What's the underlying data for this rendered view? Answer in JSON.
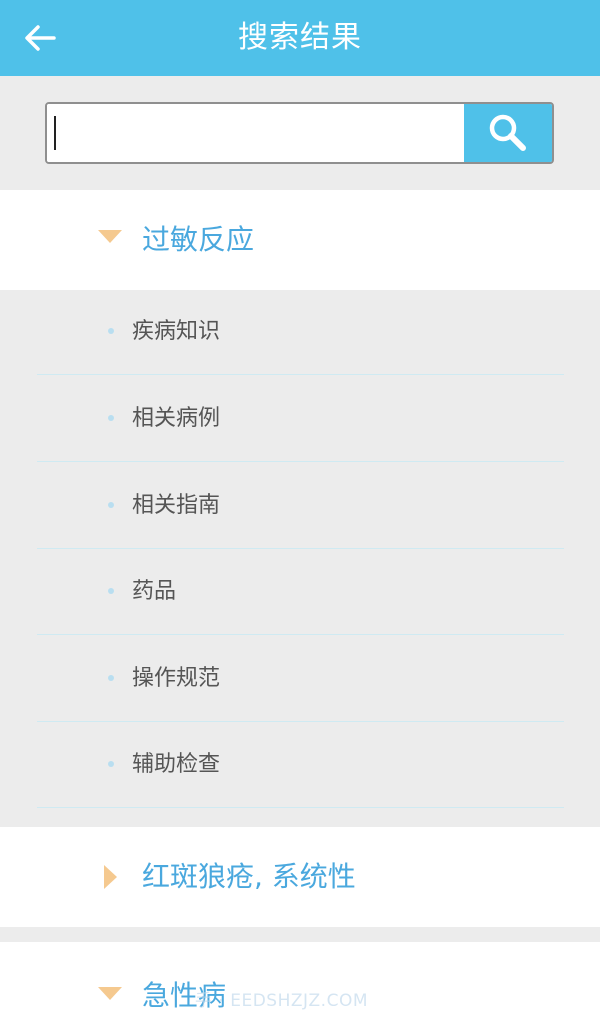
{
  "header": {
    "title": "搜索结果",
    "back_icon": "arrow-left-icon",
    "color": "#4fc1e9"
  },
  "search": {
    "value": "",
    "placeholder": "",
    "icon": "magnifier-icon"
  },
  "groups": [
    {
      "label": "过敏反应",
      "expanded": true
    },
    {
      "label": "红斑狼疮, 系统性",
      "expanded": false
    },
    {
      "label": "急性病",
      "expanded": true
    }
  ],
  "subitems": [
    {
      "label": "疾病知识"
    },
    {
      "label": "相关病例"
    },
    {
      "label": "相关指南"
    },
    {
      "label": "药品"
    },
    {
      "label": "操作规范"
    },
    {
      "label": "辅助检查"
    }
  ],
  "watermark": "手 · EEDSHZJZ.COM",
  "colors": {
    "accent": "#4fc1e9",
    "group_text": "#4aa8de",
    "arrow": "#f5c98f",
    "divider": "#cfeaf2"
  }
}
